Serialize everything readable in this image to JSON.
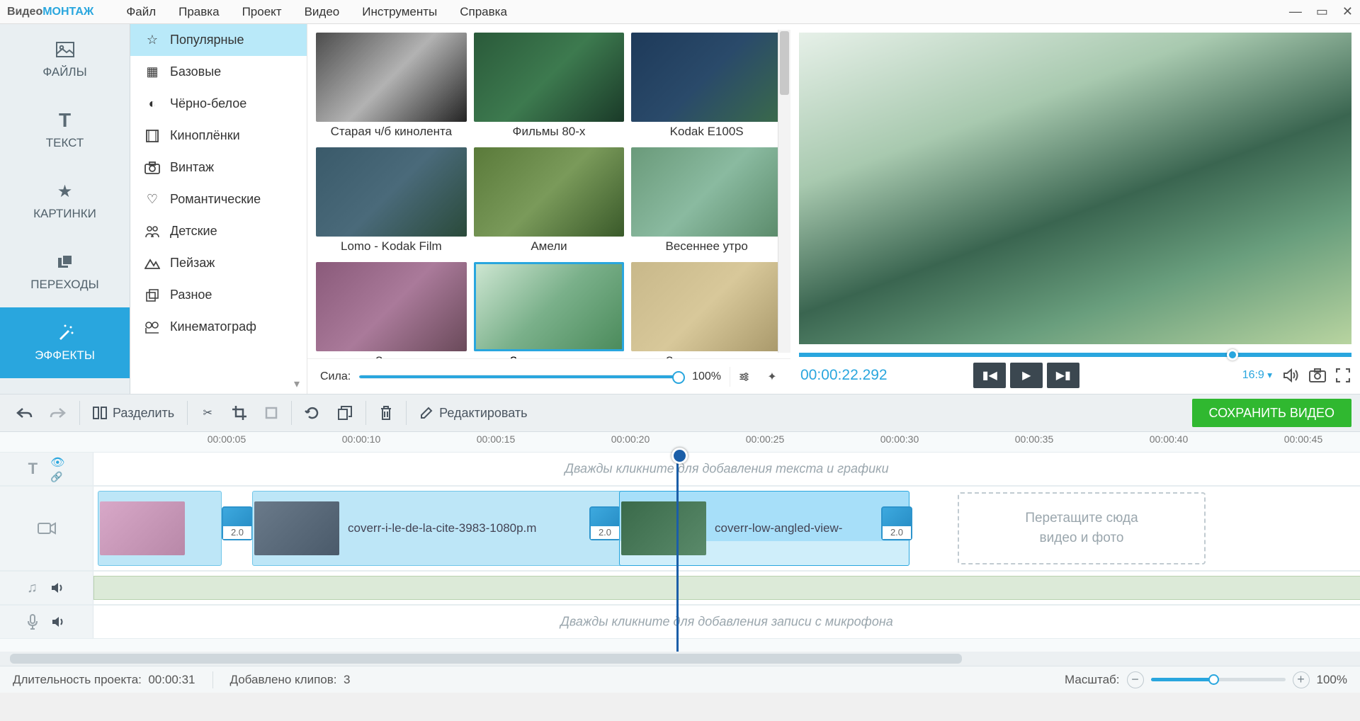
{
  "app": {
    "title1": "Видео",
    "title2": "МОНТАЖ"
  },
  "menu": [
    "Файл",
    "Правка",
    "Проект",
    "Видео",
    "Инструменты",
    "Справка"
  ],
  "nav": {
    "items": [
      {
        "id": "files",
        "label": "ФАЙЛЫ"
      },
      {
        "id": "text",
        "label": "ТЕКСТ"
      },
      {
        "id": "pictures",
        "label": "КАРТИНКИ"
      },
      {
        "id": "transitions",
        "label": "ПЕРЕХОДЫ"
      },
      {
        "id": "effects",
        "label": "ЭФФЕКТЫ"
      }
    ],
    "active": "effects"
  },
  "categories": [
    "Популярные",
    "Базовые",
    "Чёрно-белое",
    "Киноплёнки",
    "Винтаж",
    "Романтические",
    "Детские",
    "Пейзаж",
    "Разное",
    "Кинематограф"
  ],
  "categories_active": 0,
  "effects": [
    "Старая ч/б кинолента",
    "Фильмы 80-х",
    "Kodak E100S",
    "Lomo - Kodak Film",
    "Амели",
    "Весеннее утро",
    "Закат",
    "Зеленые тона",
    "Золотая осень"
  ],
  "effects_selected": 7,
  "strength": {
    "label": "Сила:",
    "value": "100%"
  },
  "preview": {
    "time": "00:00:22.292",
    "aspect": "16:9"
  },
  "toolbar": {
    "split": "Разделить",
    "edit": "Редактировать"
  },
  "save_button": "СОХРАНИТЬ ВИДЕО",
  "ruler": [
    "00:00:05",
    "00:00:10",
    "00:00:15",
    "00:00:20",
    "00:00:25",
    "00:00:30",
    "00:00:35",
    "00:00:40",
    "00:00:45"
  ],
  "timeline": {
    "text_hint": "Дважды кликните для добавления текста и графики",
    "mic_hint": "Дважды кликните для добавления записи с микрофона",
    "drop_hint_l1": "Перетащите сюда",
    "drop_hint_l2": "видео и фото",
    "clip1_name": "coverr-i-le-de-la-cite-3983-1080p.m",
    "clip2_name": "coverr-low-angled-view-",
    "trans_dur": "2.0"
  },
  "status": {
    "project_len_label": "Длительность проекта:",
    "project_len": "00:00:31",
    "clips_label": "Добавлено клипов:",
    "clips": "3",
    "zoom_label": "Масштаб:",
    "zoom": "100%"
  }
}
